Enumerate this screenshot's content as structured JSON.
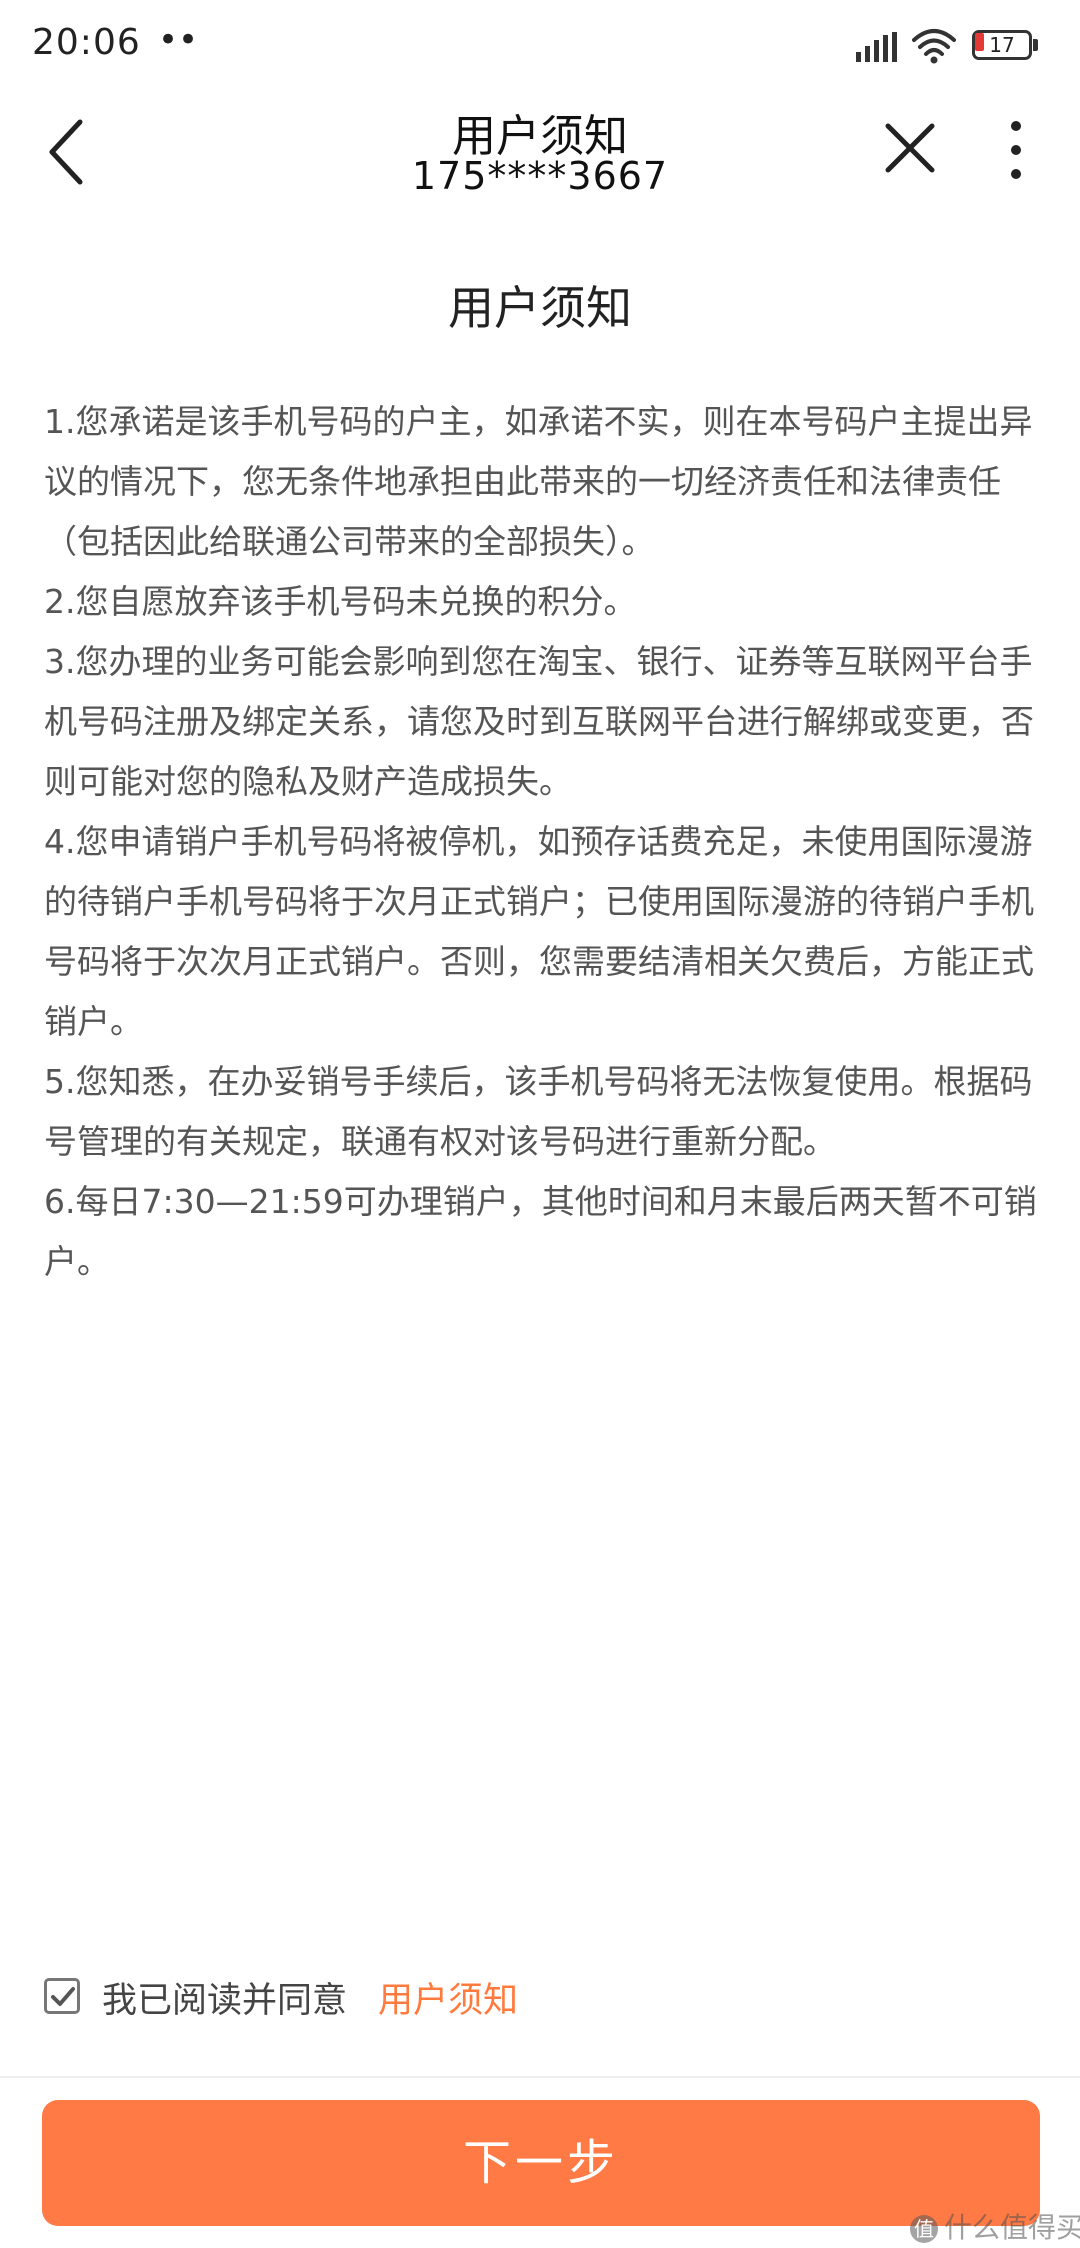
{
  "status_bar": {
    "time": "20:06",
    "dots": "••",
    "battery_level": "17",
    "battery_fraction": 0.17,
    "icons": [
      "signal-icon",
      "wifi-icon",
      "battery-icon"
    ]
  },
  "header": {
    "title": "用户须知",
    "subtitle": "175****3667",
    "icons": [
      "back-arrow-icon",
      "close-icon",
      "more-vertical-icon"
    ]
  },
  "document": {
    "title": "用户须知",
    "items": [
      "1.您承诺是该手机号码的户主，如承诺不实，则在本号码户主提出异议的情况下，您无条件地承担由此带来的一切经济责任和法律责任（包括因此给联通公司带来的全部损失）。",
      "2.您自愿放弃该手机号码未兑换的积分。",
      "3.您办理的业务可能会影响到您在淘宝、银行、证券等互联网平台手机号码注册及绑定关系，请您及时到互联网平台进行解绑或变更，否则可能对您的隐私及财产造成损失。",
      "4.您申请销户手机号码将被停机，如预存话费充足，未使用国际漫游的待销户手机号码将于次月正式销户；已使用国际漫游的待销户手机号码将于次次月正式销户。否则，您需要结清相关欠费后，方能正式销户。",
      "5.您知悉，在办妥销号手续后，该手机号码将无法恢复使用。根据码号管理的有关规定，联通有权对该号码进行重新分配。",
      "6.每日7:30—21:59可办理销户，其他时间和月末最后两天暂不可销户。"
    ]
  },
  "agreement": {
    "checked": true,
    "text": "我已阅读并同意",
    "link": "用户须知"
  },
  "footer": {
    "next_label": "下一步"
  },
  "watermark": {
    "icon_glyph": "值",
    "text": "什么值得买"
  },
  "colors": {
    "accent": "#ff7a45",
    "link": "#ff7a3d",
    "battery_low": "#e53935",
    "body_text": "#555555"
  }
}
